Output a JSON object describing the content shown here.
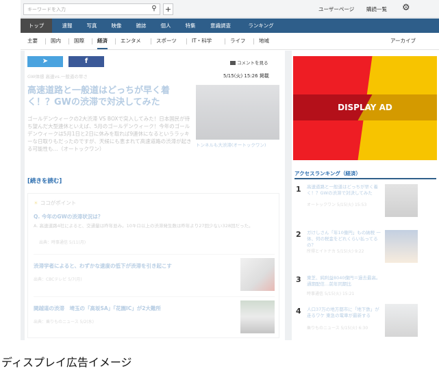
{
  "topbar": {
    "search_placeholder": "キーワードを入力",
    "search_icon": "search-icon",
    "plus_label": "+",
    "user_page": "ユーザーページ",
    "sub_list": "購読一覧",
    "settings_icon": "gear-icon"
  },
  "mainnav": {
    "items": [
      "トップ",
      "速報",
      "写真",
      "映像",
      "雑誌",
      "個人",
      "特集",
      "意識調査",
      "ランキング"
    ],
    "active": "トップ"
  },
  "subnav": {
    "items": [
      "主要",
      "国内",
      "国際",
      "経済",
      "エンタメ",
      "スポーツ",
      "IT・科学",
      "ライフ",
      "地域"
    ],
    "active": "経済",
    "archive": "アーカイブ"
  },
  "article": {
    "comment_link": "コメントを見る",
    "meta": "GW体感 高速vs.一般道の早さ",
    "date": "5/15(火) 15:26 掲載",
    "headline": "高速道路と一般道はどっちが早く着く！？GWの渋滞で対決してみた",
    "body": "ゴールデンウィークの2大渋滞 VS BOXで突入してみた！日本国民が待ち望んだ大型連休といえば、5月のゴールデンウィーク！今年のゴールデンウィークは5月1日と2日に休みを取れば9連休になるというラッキーな日取りもだったのですが、天候にも恵まれて高速道路の渋滞が起きる可能性も…（オートックワン）",
    "photo_caption": "トンネルも大渋滞(オートックワン)",
    "read_more": "[続きを読む]"
  },
  "point": {
    "title": "ココがポイント",
    "question": "Q. 今年のGWの渋滞状況は？",
    "answer": "A. 高速道路4社によると、交通量は昨年並み。10キロ以上の渋滞発生数は昨年より27回少ない328回だった。",
    "answer_source": "出典：時事通信 5/11(月)",
    "related": [
      {
        "title": "渋滞学者によると、わずかな速度の低下が渋滞を引き起こす",
        "source": "出典：CBCテレビ 5/7(月)"
      },
      {
        "title": "関越道の渋滞　埼玉の「高坂SA」「花園IC」が2大難所",
        "source": "出典：乗りものニュース 5/2(水)"
      }
    ]
  },
  "ad": {
    "label": "DISPLAY AD",
    "colors": {
      "red": "#ee1d24",
      "yellow": "#f7c400",
      "band": "#b4101a"
    }
  },
  "ranking": {
    "title": "アクセスランキング（経済）",
    "items": [
      {
        "rank": "1",
        "title": "高速道路と一般道はどっちが早く着く！？GWの渋滞で対決してみた",
        "source": "オートックワン 5/15(火) 15:53"
      },
      {
        "rank": "2",
        "title": "ガけしさん「年10億円」もの納税 一体、何の税金をどれくらい払ってるの？",
        "source": "所得とイトナカ 5/15(火) 9:22"
      },
      {
        "rank": "3",
        "title": "東芝、純利益8040億円＝過去最高。通期配信…前年同期比",
        "source": "時事通信 5/15(火) 15:21"
      },
      {
        "rank": "4",
        "title": "人口37万の地方都市に「地下鉄」が走るワケ 東急の電車が最新する",
        "source": "乗りものニュース 5/15(火) 6:30"
      }
    ]
  },
  "caption": "ディスプレイ広告イメージ"
}
